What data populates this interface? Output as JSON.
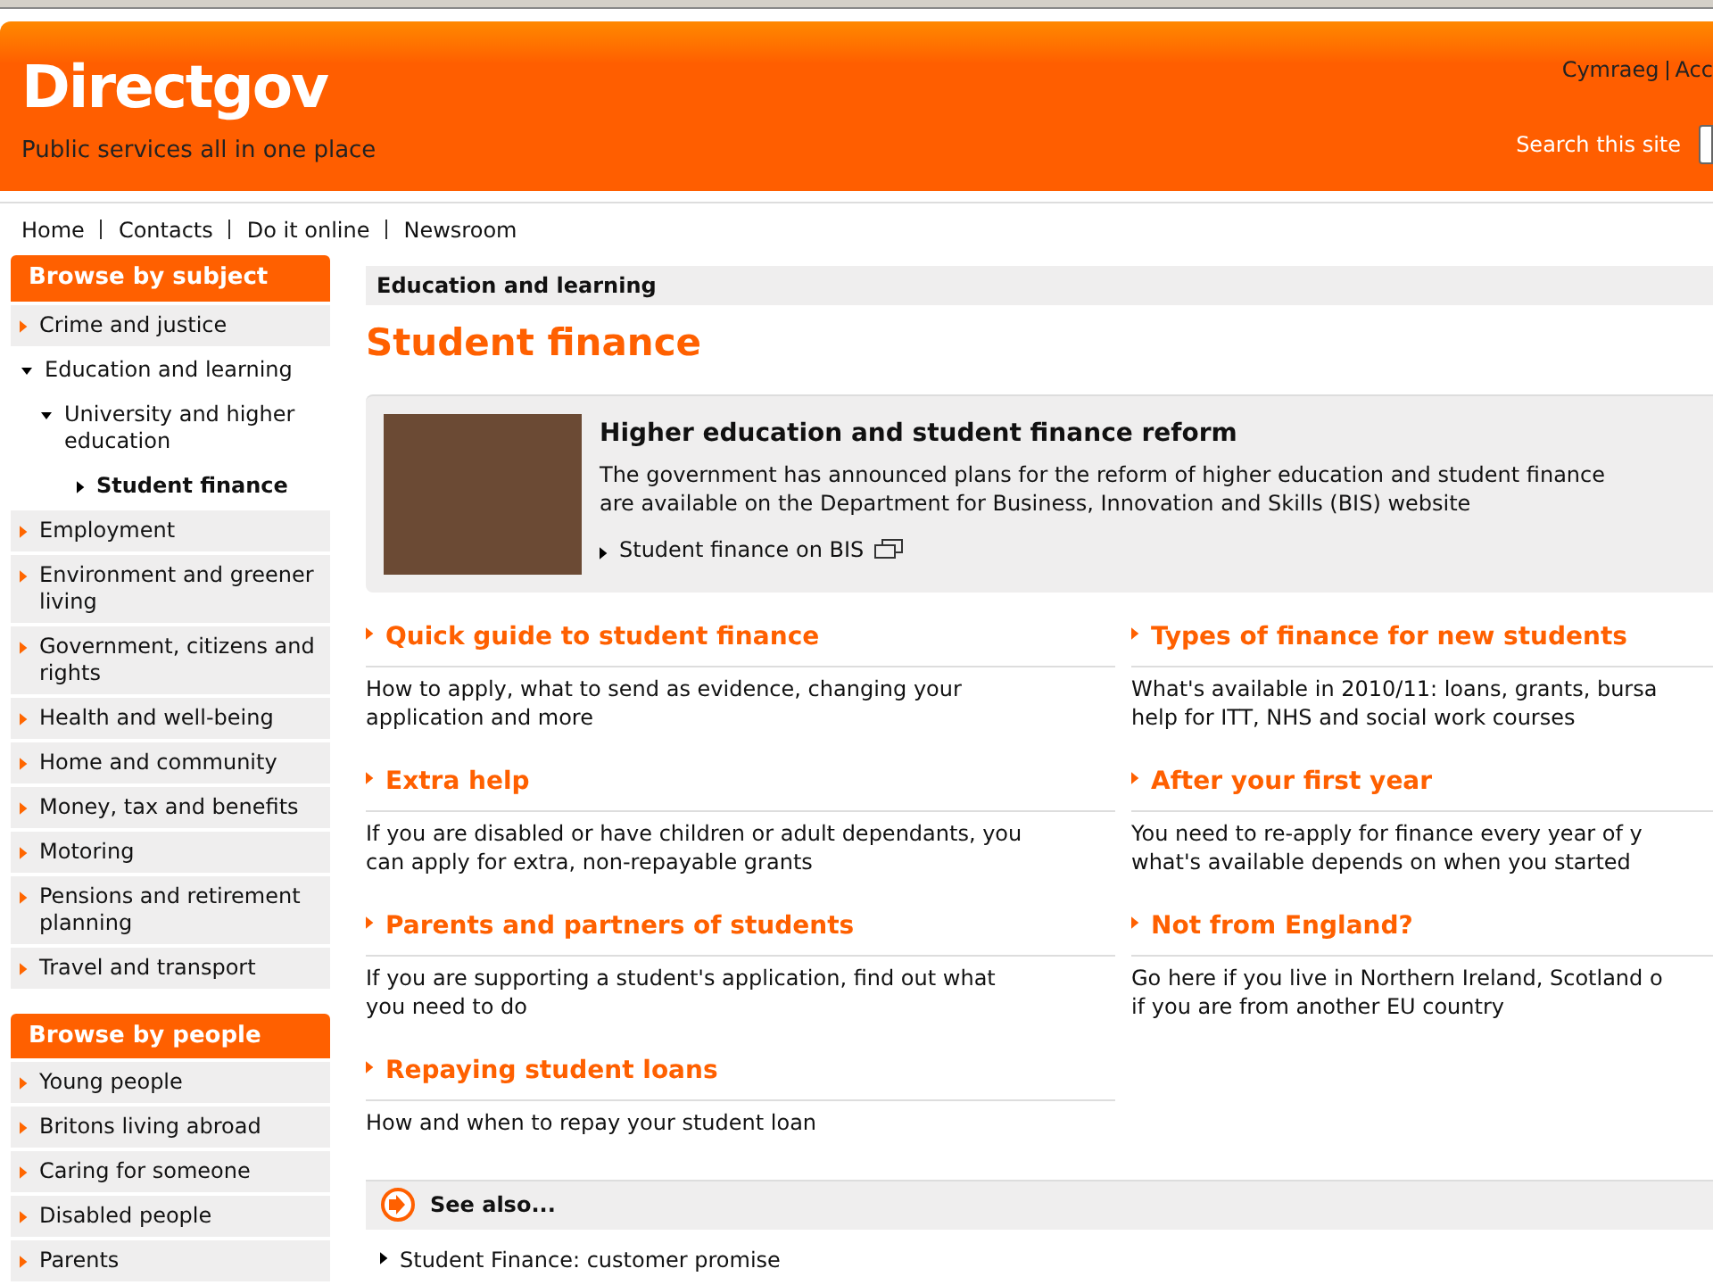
{
  "header": {
    "logo": "Directgov",
    "tagline": "Public services all in one place",
    "top_links": [
      "Cymraeg",
      "Acc"
    ],
    "search_label": "Search this site"
  },
  "nav": [
    "Home",
    "Contacts",
    "Do it online",
    "Newsroom"
  ],
  "sidebar": [
    {
      "title": "Browse by subject",
      "items": [
        {
          "label": "Crime and justice",
          "expanded": false,
          "selected": false
        },
        {
          "label": "Education and learning",
          "expanded": true,
          "selected": false,
          "children": [
            {
              "label": "University and higher education",
              "expanded": true,
              "selected": false,
              "children": [
                {
                  "label": "Student finance",
                  "expanded": false,
                  "selected": true
                }
              ]
            }
          ]
        },
        {
          "label": "Employment",
          "expanded": false,
          "selected": false
        },
        {
          "label": "Environment and greener living",
          "expanded": false,
          "selected": false
        },
        {
          "label": "Government, citizens and rights",
          "expanded": false,
          "selected": false
        },
        {
          "label": "Health and well-being",
          "expanded": false,
          "selected": false
        },
        {
          "label": "Home and community",
          "expanded": false,
          "selected": false
        },
        {
          "label": "Money, tax and benefits",
          "expanded": false,
          "selected": false
        },
        {
          "label": "Motoring",
          "expanded": false,
          "selected": false
        },
        {
          "label": "Pensions and retirement planning",
          "expanded": false,
          "selected": false
        },
        {
          "label": "Travel and transport",
          "expanded": false,
          "selected": false
        }
      ]
    },
    {
      "title": "Browse by people",
      "items": [
        {
          "label": "Young people",
          "expanded": false,
          "selected": false
        },
        {
          "label": "Britons living abroad",
          "expanded": false,
          "selected": false
        },
        {
          "label": "Caring for someone",
          "expanded": false,
          "selected": false
        },
        {
          "label": "Disabled people",
          "expanded": false,
          "selected": false
        },
        {
          "label": "Parents",
          "expanded": false,
          "selected": false
        }
      ]
    }
  ],
  "breadcrumb": "Education and learning",
  "page_title": "Student finance",
  "feature": {
    "title": "Higher education and student finance reform",
    "text_lines": [
      "The government has announced plans for the reform of higher education and student finance",
      "are available on the Department for Business, Innovation and Skills (BIS) website"
    ],
    "link": "Student finance on BIS"
  },
  "topics": [
    {
      "title": "Quick guide to student finance",
      "lines": [
        "How to apply, what to send as evidence, changing your",
        "application and more"
      ]
    },
    {
      "title": "Types of finance for new students",
      "lines": [
        "What's available in 2010/11: loans, grants, bursa",
        "help for ITT, NHS and social work courses"
      ]
    },
    {
      "title": "Extra help",
      "lines": [
        "If you are disabled or have children or adult dependants, you",
        "can apply for extra, non-repayable grants"
      ]
    },
    {
      "title": "After your first year",
      "lines": [
        "You need to re-apply for finance every year of y",
        "what's available depends on when you started"
      ]
    },
    {
      "title": "Parents and partners of students",
      "lines": [
        "If you are supporting a student's application, find out what",
        "you need to do"
      ]
    },
    {
      "title": "Not from England?",
      "lines": [
        "Go here if you live in Northern Ireland, Scotland o",
        "if you are from another EU country"
      ]
    },
    {
      "title": "Repaying student loans",
      "lines": [
        "How and when to repay your student loan"
      ]
    }
  ],
  "see_also": {
    "title": "See also...",
    "links": [
      "Student Finance: customer promise"
    ]
  }
}
